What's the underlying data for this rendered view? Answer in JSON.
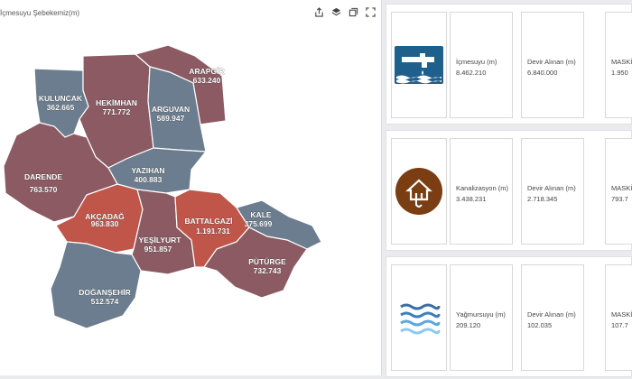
{
  "map": {
    "title": "İçmesuyu Şebekemiz(m)",
    "colors": {
      "slate": "#6b7d8e",
      "mauve": "#8b5a63",
      "red": "#c0554a"
    },
    "districts": [
      {
        "name": "KULUNCAK",
        "value": "362.665"
      },
      {
        "name": "HEKİMHAN",
        "value": "771.772"
      },
      {
        "name": "ARAPGİR",
        "value": "633.240"
      },
      {
        "name": "ARGUVAN",
        "value": "589.947"
      },
      {
        "name": "YAZIHAN",
        "value": "400.883"
      },
      {
        "name": "DARENDE",
        "value": "763.570"
      },
      {
        "name": "AKÇADAĞ",
        "value": "963.830"
      },
      {
        "name": "BATTALGAZİ",
        "value": "1.191.731"
      },
      {
        "name": "KALE",
        "value": "375.699"
      },
      {
        "name": "YEŞİLYURT",
        "value": "951.857"
      },
      {
        "name": "PÜTÜRGE",
        "value": "732.743"
      },
      {
        "name": "DOĞANŞEHİR",
        "value": "512.574"
      }
    ]
  },
  "toolbar": {
    "icons": [
      "share-icon",
      "layers-icon",
      "copy-icon",
      "expand-icon"
    ]
  },
  "cards": [
    {
      "icon": "water-tap-icon",
      "label": "İçmesuyu (m)",
      "value": "8.462.210",
      "devir_label": "Devir Alınan (m)",
      "devir_value": "6.840.000",
      "mask_label": "MASKİ",
      "mask_value": "1.950"
    },
    {
      "icon": "sewer-house-icon",
      "label": "Kanalizasyon (m)",
      "value": "3.438.231",
      "devir_label": "Devir Alınan (m)",
      "devir_value": "2.718.345",
      "mask_label": "MASKİ",
      "mask_value": "793.7"
    },
    {
      "icon": "rain-waves-icon",
      "label": "Yağmursuyu (m)",
      "value": "209.120",
      "devir_label": "Devir Alınan (m)",
      "devir_value": "102.035",
      "mask_label": "MASKİ",
      "mask_value": "107.7"
    }
  ]
}
